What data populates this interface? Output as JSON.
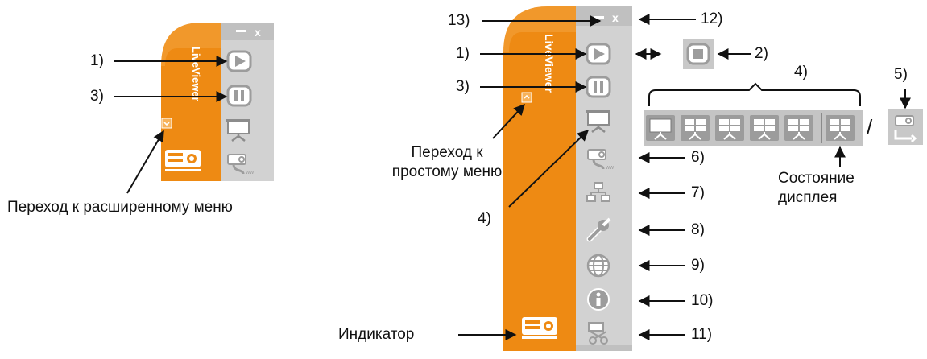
{
  "left_panel": {
    "logo_text": "LiveViewer",
    "callouts": {
      "play": "1)",
      "pause": "3)"
    },
    "expand_caption": "Переход к расширенному меню"
  },
  "right_panel": {
    "logo_text": "LiveViewer",
    "callouts": {
      "minimize": "13)",
      "close": "12)",
      "play": "1)",
      "stop_variant": "2)",
      "pause": "3)",
      "display_group": "4)",
      "display_button": "4)",
      "single_display": "5)",
      "mute_projector": "6)",
      "network": "7)",
      "settings": "8)",
      "web": "9)",
      "info": "10)",
      "disconnect": "11)"
    },
    "collapse_caption": "Переход к\nпростому меню",
    "display_state_caption": "Состояние\nдисплея",
    "indicator_caption": "Индикатор",
    "slash": "/"
  },
  "colors": {
    "orange": "#EE8A13",
    "orange_light": "#F7B25A",
    "panel_grey": "#D2D2D2",
    "icon_grey": "#9C9C9C",
    "icon_white": "#FFFFFF",
    "line": "#111111"
  }
}
